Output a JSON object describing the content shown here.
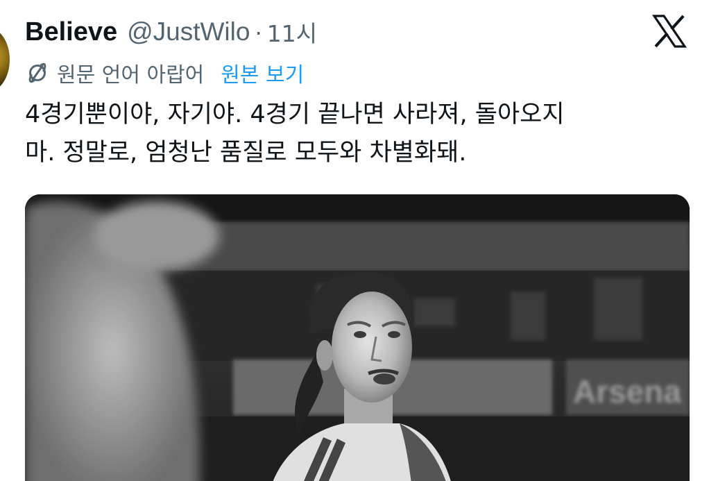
{
  "author": {
    "display_name": "Believe",
    "handle": "@JustWilo",
    "separator": "·",
    "time": "11시"
  },
  "translation": {
    "label": "원문 언어 아랍어",
    "show_original": "원본 보기"
  },
  "tweet": {
    "lines": [
      "4경기뿐이야, 자기야. 4경기 끝나면 사라져, 돌아오지",
      "마. 정말로, 엄청난 품질로 모두와 차별화돼."
    ]
  },
  "media": {
    "signboard_text": "Arsena",
    "colors": {
      "background": "#2a2a2a"
    }
  },
  "icons": {
    "brand": "x-logo-icon",
    "translate": "translate-icon"
  },
  "colors": {
    "text_primary": "#0f1419",
    "text_secondary": "#536471",
    "link": "#1d9bf0"
  }
}
